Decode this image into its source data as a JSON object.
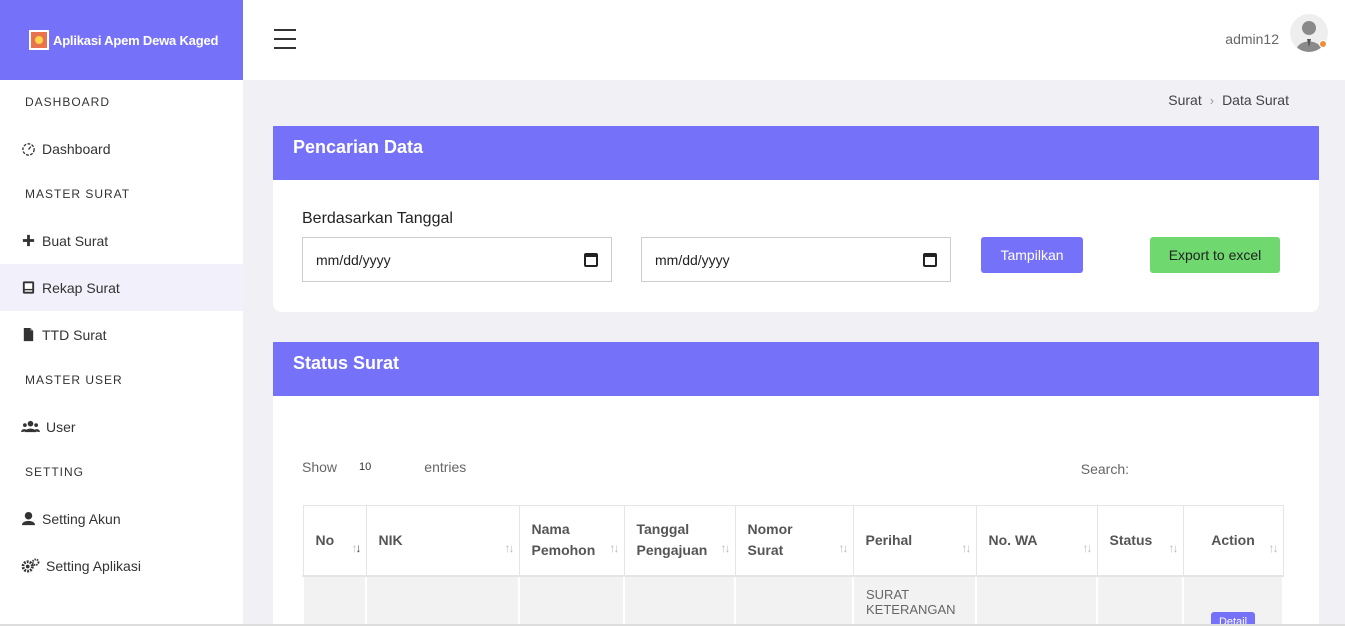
{
  "app": {
    "name": "Aplikasi Apem Dewa Kaged"
  },
  "header": {
    "username": "admin12"
  },
  "sidebar": {
    "sections": [
      {
        "label": "DASHBOARD",
        "items": [
          {
            "label": "Dashboard",
            "icon": "dashboard-icon"
          }
        ]
      },
      {
        "label": "MASTER SURAT",
        "items": [
          {
            "label": "Buat Surat",
            "icon": "plus-icon"
          },
          {
            "label": "Rekap Surat",
            "icon": "book-icon",
            "active": true
          },
          {
            "label": "TTD Surat",
            "icon": "file-icon"
          }
        ]
      },
      {
        "label": "MASTER USER",
        "items": [
          {
            "label": "User",
            "icon": "users-icon"
          }
        ]
      },
      {
        "label": "SETTING",
        "items": [
          {
            "label": "Setting Akun",
            "icon": "user-icon"
          },
          {
            "label": "Setting Aplikasi",
            "icon": "gears-icon"
          }
        ]
      }
    ]
  },
  "breadcrumb": {
    "parent": "Surat",
    "current": "Data Surat"
  },
  "search_card": {
    "title": "Pencarian Data",
    "filter_label": "Berdasarkan Tanggal",
    "start_date_placeholder": "mm/dd/yyyy",
    "end_date_placeholder": "mm/dd/yyyy",
    "show_button": "Tampilkan",
    "export_button": "Export to excel"
  },
  "status_card": {
    "title": "Status Surat",
    "show_label": "Show",
    "entries_value": "10",
    "entries_label": "entries",
    "search_label": "Search:",
    "columns": [
      "No",
      "NIK",
      "Nama Pemohon",
      "Tanggal Pengajuan",
      "Nomor Surat",
      "Perihal",
      "No. WA",
      "Status",
      "Action"
    ],
    "first_row": {
      "perihal": "SURAT KETERANGAN",
      "action": "Detail"
    }
  },
  "colors": {
    "accent": "#7571f9",
    "success": "#6fd96f"
  }
}
